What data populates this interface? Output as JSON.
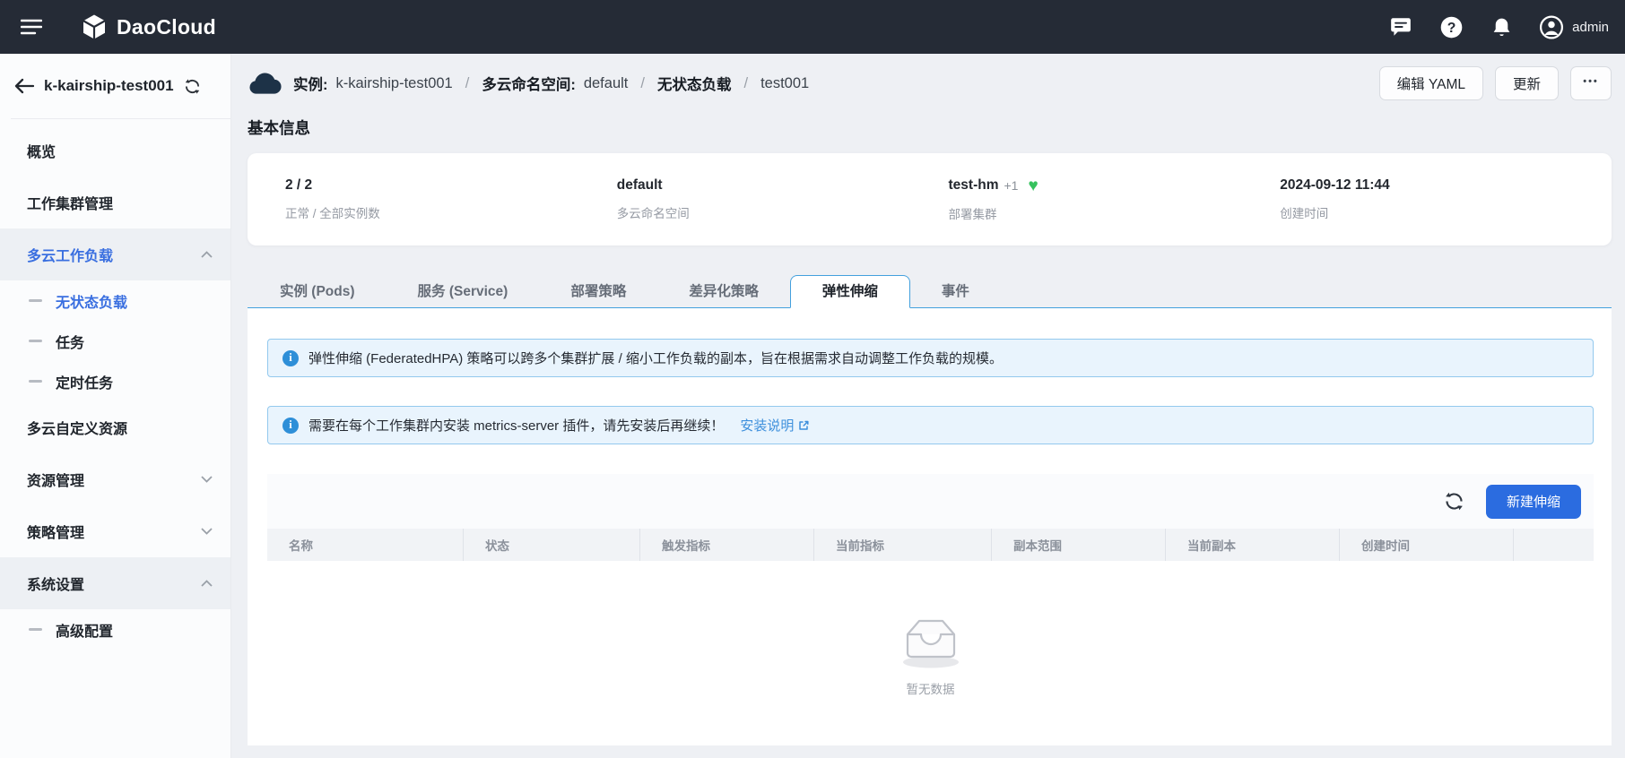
{
  "topbar": {
    "brand": "DaoCloud",
    "user": "admin"
  },
  "sidebar": {
    "title": "k-kairship-test001",
    "items": [
      {
        "label": "概览"
      },
      {
        "label": "工作集群管理"
      },
      {
        "label": "多云工作负载"
      },
      {
        "label": "无状态负载"
      },
      {
        "label": "任务"
      },
      {
        "label": "定时任务"
      },
      {
        "label": "多云自定义资源"
      },
      {
        "label": "资源管理"
      },
      {
        "label": "策略管理"
      },
      {
        "label": "系统设置"
      },
      {
        "label": "高级配置"
      }
    ]
  },
  "header": {
    "breadcrumb": {
      "instance_label": "实例:",
      "instance_value": "k-kairship-test001",
      "sep1": "/",
      "namespace_label": "多云命名空间:",
      "namespace_value": "default",
      "sep2": "/",
      "workload_label": "无状态负载",
      "sep3": "/",
      "name": "test001"
    },
    "actions": {
      "edit_yaml": "编辑 YAML",
      "update": "更新",
      "more": "•••"
    }
  },
  "basic_info": {
    "title": "基本信息",
    "fields": [
      {
        "value": "2 / 2",
        "label": "正常 / 全部实例数"
      },
      {
        "value": "default",
        "label": "多云命名空间"
      },
      {
        "value": "test-hm",
        "extra": "+1",
        "heart_icon": "♥",
        "label": "部署集群"
      },
      {
        "value": "2024-09-12 11:44",
        "label": "创建时间"
      }
    ]
  },
  "tabs": [
    {
      "label": "实例 (Pods)"
    },
    {
      "label": "服务 (Service)"
    },
    {
      "label": "部署策略"
    },
    {
      "label": "差异化策略"
    },
    {
      "label": "弹性伸缩"
    },
    {
      "label": "事件"
    }
  ],
  "alerts": [
    {
      "icon": "i",
      "text": "弹性伸缩 (FederatedHPA) 策略可以跨多个集群扩展 / 缩小工作负载的副本，旨在根据需求自动调整工作负载的规模。"
    },
    {
      "icon": "i",
      "text": "需要在每个工作集群内安装 metrics-server 插件，请先安装后再继续！",
      "link": "安装说明"
    }
  ],
  "table": {
    "create_button": "新建伸缩",
    "columns": [
      "名称",
      "状态",
      "触发指标",
      "当前指标",
      "副本范围",
      "当前副本",
      "创建时间",
      ""
    ],
    "empty_text": "暂无数据"
  },
  "colors": {
    "topbar_bg": "#252b36",
    "accent_blue": "#2b6ce0",
    "active_text_blue": "#3a6fe0",
    "link_blue": "#3d8fdc",
    "tab_border_blue": "#43a0dd",
    "alert_bg": "#e9f4fd",
    "alert_border": "#93c9ee",
    "health_green": "#36c25e"
  }
}
